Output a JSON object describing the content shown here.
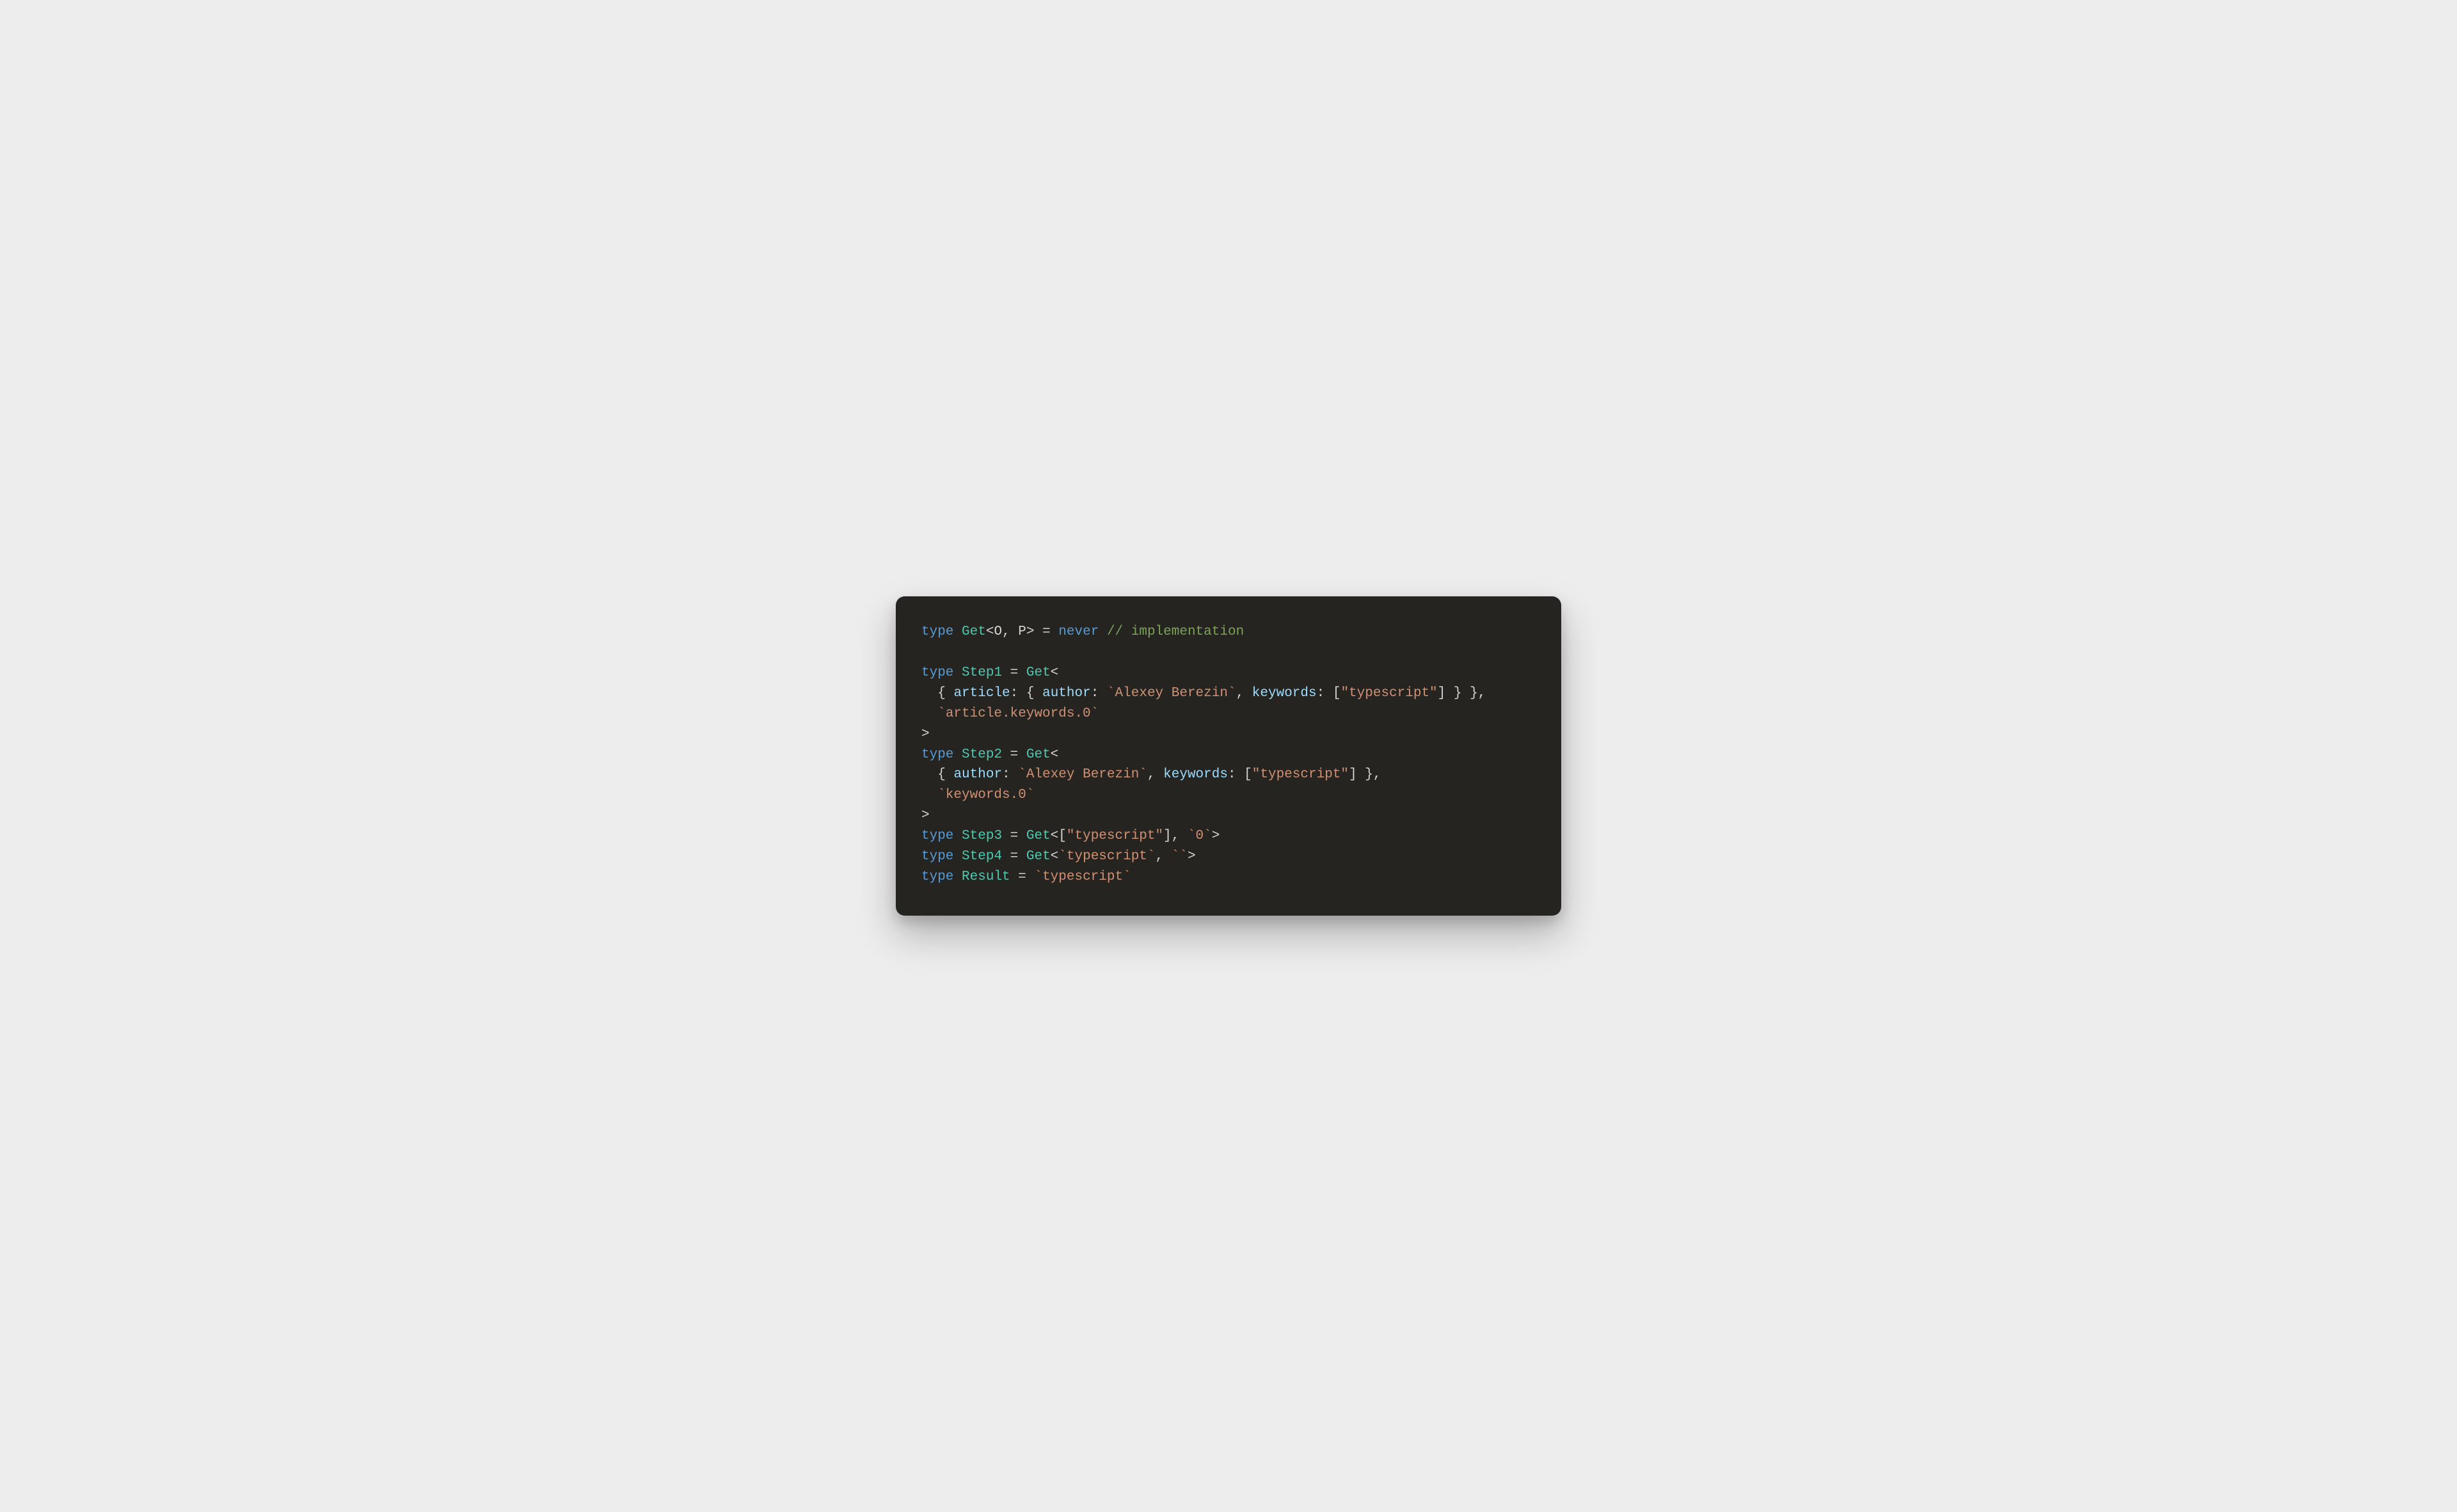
{
  "code": {
    "line1": {
      "kw_type": "type",
      "name_get": "Get",
      "lt": "<",
      "param_o": "O",
      "comma": ", ",
      "param_p": "P",
      "gt": ">",
      "eq": " = ",
      "kw_never": "never",
      "sp": " ",
      "comment": "// implementation"
    },
    "line3": {
      "kw_type": "type",
      "name": "Step1",
      "eq": " = ",
      "name_get": "Get",
      "lt": "<"
    },
    "line4": {
      "indent": "  ",
      "brace_o1": "{ ",
      "prop_article": "article",
      "colon1": ": ",
      "brace_o2": "{ ",
      "prop_author": "author",
      "colon2": ": ",
      "str_author": "`Alexey Berezin`",
      "comma1": ", ",
      "prop_keywords": "keywords",
      "colon3": ": [",
      "str_ts": "\"typescript\"",
      "close1": "] } },"
    },
    "line5": {
      "indent": "  ",
      "str_path": "`article.keywords.0`"
    },
    "line6": {
      "gt": ">"
    },
    "line7": {
      "kw_type": "type",
      "name": "Step2",
      "eq": " = ",
      "name_get": "Get",
      "lt": "<"
    },
    "line8": {
      "indent": "  ",
      "brace_o": "{ ",
      "prop_author": "author",
      "colon1": ": ",
      "str_author": "`Alexey Berezin`",
      "comma1": ", ",
      "prop_keywords": "keywords",
      "colon2": ": [",
      "str_ts": "\"typescript\"",
      "close": "] },"
    },
    "line9": {
      "indent": "  ",
      "str_path": "`keywords.0`"
    },
    "line10": {
      "gt": ">"
    },
    "line11": {
      "kw_type": "type",
      "name": "Step3",
      "eq": " = ",
      "name_get": "Get",
      "lt": "<[",
      "str_ts": "\"typescript\"",
      "mid": "], ",
      "str_zero": "`0`",
      "gt": ">"
    },
    "line12": {
      "kw_type": "type",
      "name": "Step4",
      "eq": " = ",
      "name_get": "Get",
      "lt": "<",
      "str_ts": "`typescript`",
      "comma": ", ",
      "str_empty": "``",
      "gt": ">"
    },
    "line13": {
      "kw_type": "type",
      "name": "Result",
      "eq": " = ",
      "str_ts": "`typescript`"
    }
  }
}
